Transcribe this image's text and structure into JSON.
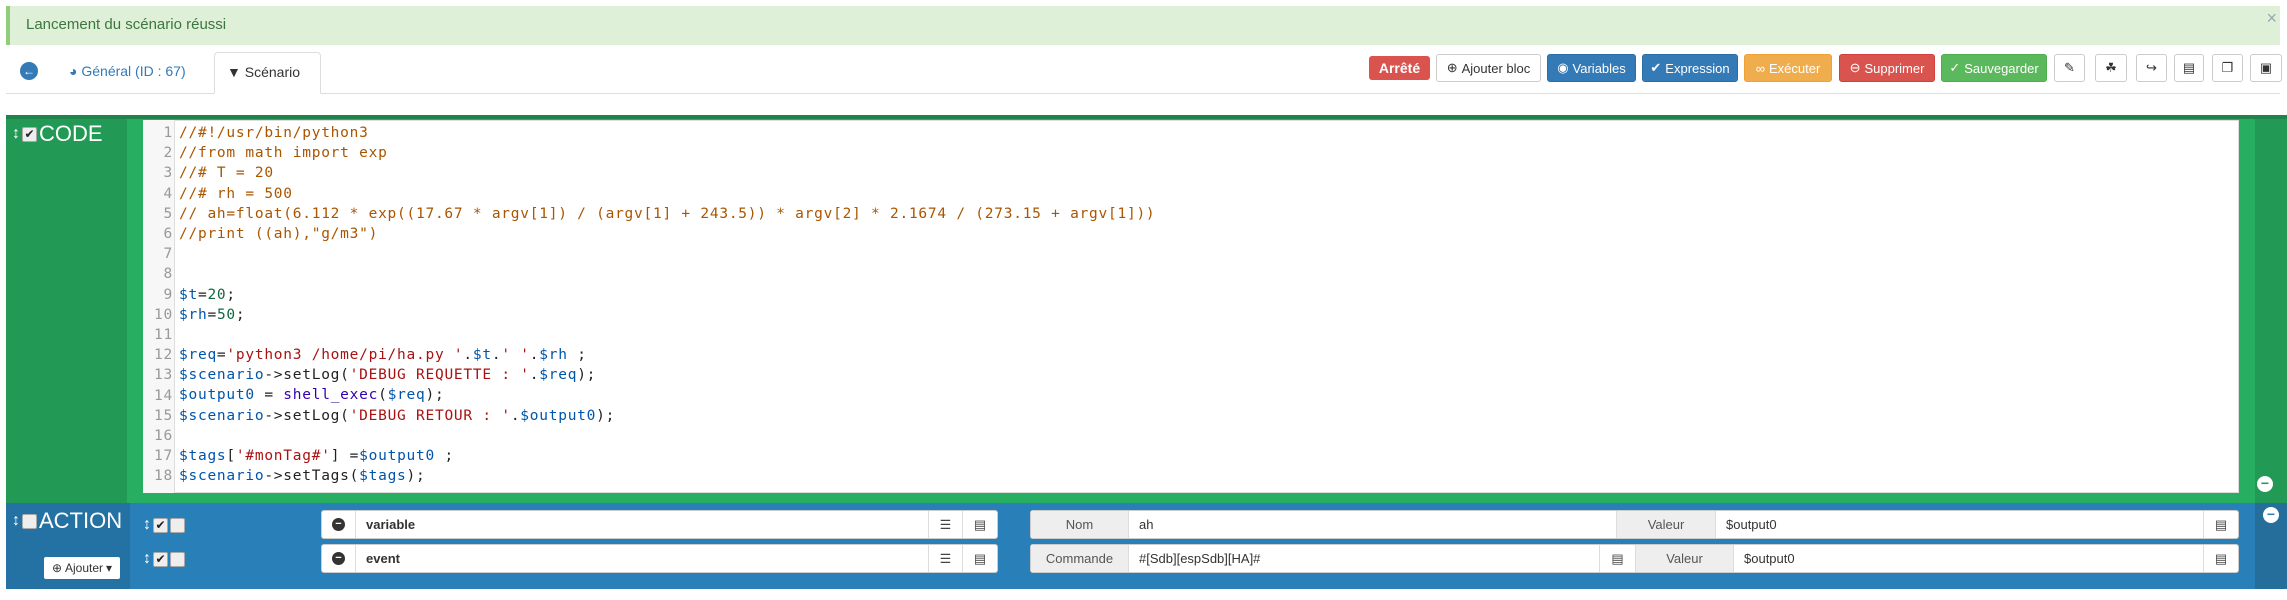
{
  "alert": {
    "message": "Lancement du scénario réussi",
    "close": "×"
  },
  "tabs": {
    "back": "←",
    "general": "Général (ID : 67)",
    "scenario": "Scénario"
  },
  "toolbar": {
    "state": "Arrêté",
    "add_block": "Ajouter bloc",
    "variables": "Variables",
    "expression": "Expression",
    "execute": "Exécuter",
    "delete": "Supprimer",
    "save": "Sauvegarder"
  },
  "colors": {
    "code_block": "#229954",
    "action_block": "#2980b9",
    "state": "#d9534f"
  },
  "code_block": {
    "title": "CODE",
    "enabled": true,
    "lines": [
      [
        [
          "comment",
          "//#!/usr/bin/python3"
        ]
      ],
      [
        [
          "comment",
          "//from math import exp"
        ]
      ],
      [
        [
          "comment",
          "//# T = 20"
        ]
      ],
      [
        [
          "comment",
          "//# rh = 500"
        ]
      ],
      [
        [
          "comment",
          "// ah=float(6.112 * exp((17.67 * argv[1]) / (argv[1] + 243.5)) * argv[2] * 2.1674 / (273.15 + argv[1]))"
        ]
      ],
      [
        [
          "comment",
          "//print ((ah),\"g/m3\")"
        ]
      ],
      [],
      [],
      [
        [
          "var",
          "$t"
        ],
        [
          "plain",
          "="
        ],
        [
          "num",
          "20"
        ],
        [
          "plain",
          ";"
        ]
      ],
      [
        [
          "var",
          "$rh"
        ],
        [
          "plain",
          "="
        ],
        [
          "num",
          "50"
        ],
        [
          "plain",
          ";"
        ]
      ],
      [],
      [
        [
          "var",
          "$req"
        ],
        [
          "plain",
          "="
        ],
        [
          "str",
          "'python3 /home/pi/ha.py '"
        ],
        [
          "plain",
          "."
        ],
        [
          "var",
          "$t"
        ],
        [
          "plain",
          "."
        ],
        [
          "str",
          "' '"
        ],
        [
          "plain",
          "."
        ],
        [
          "var",
          "$rh"
        ],
        [
          "plain",
          " ;"
        ]
      ],
      [
        [
          "var",
          "$scenario"
        ],
        [
          "plain",
          "->setLog("
        ],
        [
          "str",
          "'DEBUG REQUETTE : '"
        ],
        [
          "plain",
          "."
        ],
        [
          "var",
          "$req"
        ],
        [
          "plain",
          ");"
        ]
      ],
      [
        [
          "var",
          "$output0"
        ],
        [
          "plain",
          " = "
        ],
        [
          "fn",
          "shell_exec"
        ],
        [
          "plain",
          "("
        ],
        [
          "var",
          "$req"
        ],
        [
          "plain",
          ");"
        ]
      ],
      [
        [
          "var",
          "$scenario"
        ],
        [
          "plain",
          "->setLog("
        ],
        [
          "str",
          "'DEBUG RETOUR : '"
        ],
        [
          "plain",
          "."
        ],
        [
          "var",
          "$output0"
        ],
        [
          "plain",
          ");"
        ]
      ],
      [],
      [
        [
          "var",
          "$tags"
        ],
        [
          "plain",
          "["
        ],
        [
          "str",
          "'#monTag#'"
        ],
        [
          "plain",
          "] ="
        ],
        [
          "var",
          "$output0"
        ],
        [
          "plain",
          " ;"
        ]
      ],
      [
        [
          "var",
          "$scenario"
        ],
        [
          "plain",
          "->setTags("
        ],
        [
          "var",
          "$tags"
        ],
        [
          "plain",
          ");"
        ]
      ]
    ]
  },
  "action_block": {
    "title": "ACTION",
    "enabled": false,
    "add_label": "Ajouter",
    "rows": [
      {
        "type": "variable",
        "label1": "Nom",
        "value1": "ah",
        "label2": "Valeur",
        "value2": "$output0"
      },
      {
        "type": "event",
        "label1": "Commande",
        "value1": "#[Sdb][espSdb][HA]#",
        "label2": "Valeur",
        "value2": "$output0"
      }
    ]
  }
}
